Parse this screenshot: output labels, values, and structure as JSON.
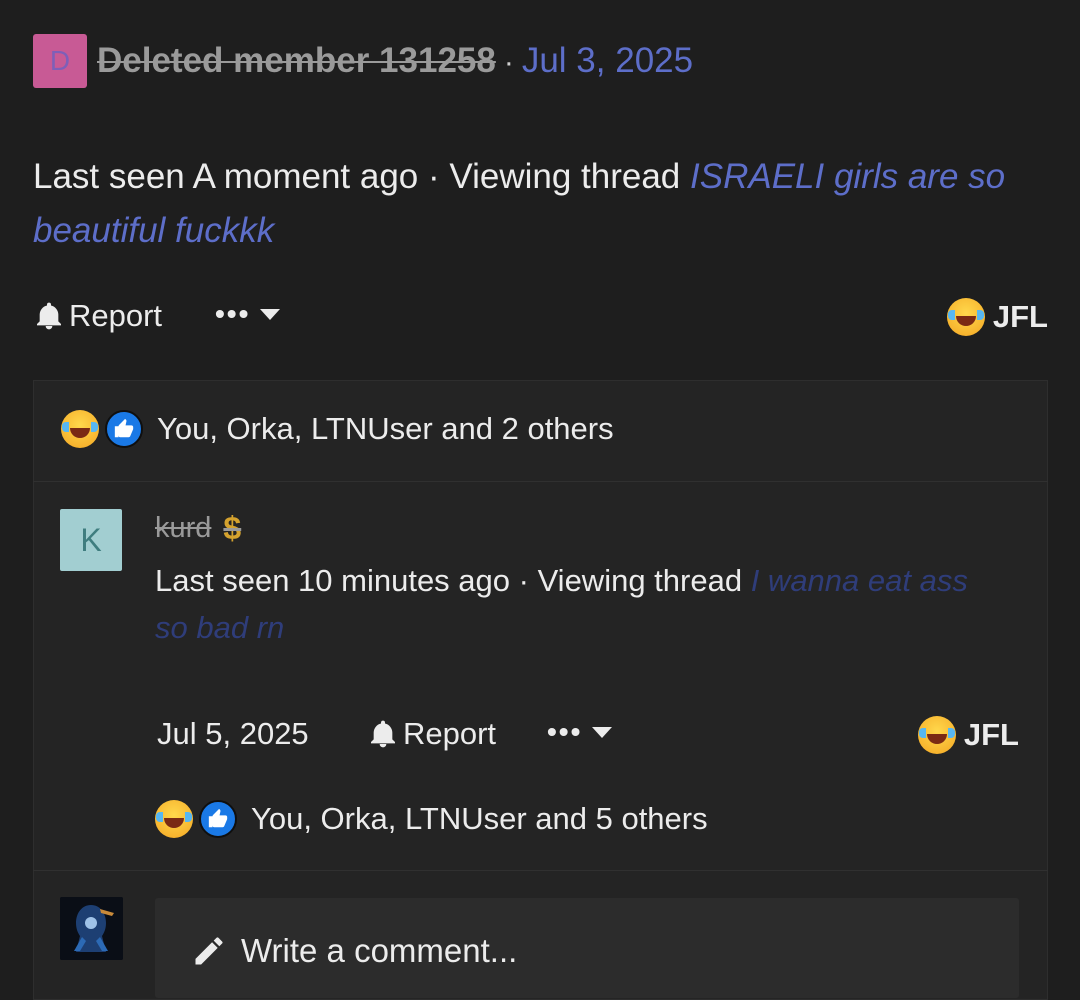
{
  "post": {
    "avatar_letter": "D",
    "author": "Deleted member 131258",
    "separator": "·",
    "date": "Jul 3, 2025",
    "last_seen": "Last seen A moment ago · Viewing thread ",
    "thread_title": "ISRAELI girls are so beautiful fuckkk",
    "report_label": "Report",
    "more_label": "•••",
    "reaction_label": "JFL",
    "reactions_summary": "You, Orka, LTNUser and 2 others"
  },
  "reply": {
    "avatar_letter": "K",
    "author": "kurd",
    "badge": "$",
    "last_seen": "Last seen 10 minutes ago · Viewing thread ",
    "thread_title": "I wanna eat ass so bad rn",
    "date": "Jul 5, 2025",
    "report_label": "Report",
    "more_label": "•••",
    "reaction_label": "JFL",
    "reactions_summary": "You, Orka, LTNUser and 5 others"
  },
  "composer": {
    "placeholder": "Write a comment..."
  },
  "colors": {
    "background": "#1e1e1e",
    "link": "#5d6ec9",
    "link_dim": "#2f3d7a",
    "avatar_d": "#c85a95",
    "avatar_k": "#a2ced1"
  }
}
